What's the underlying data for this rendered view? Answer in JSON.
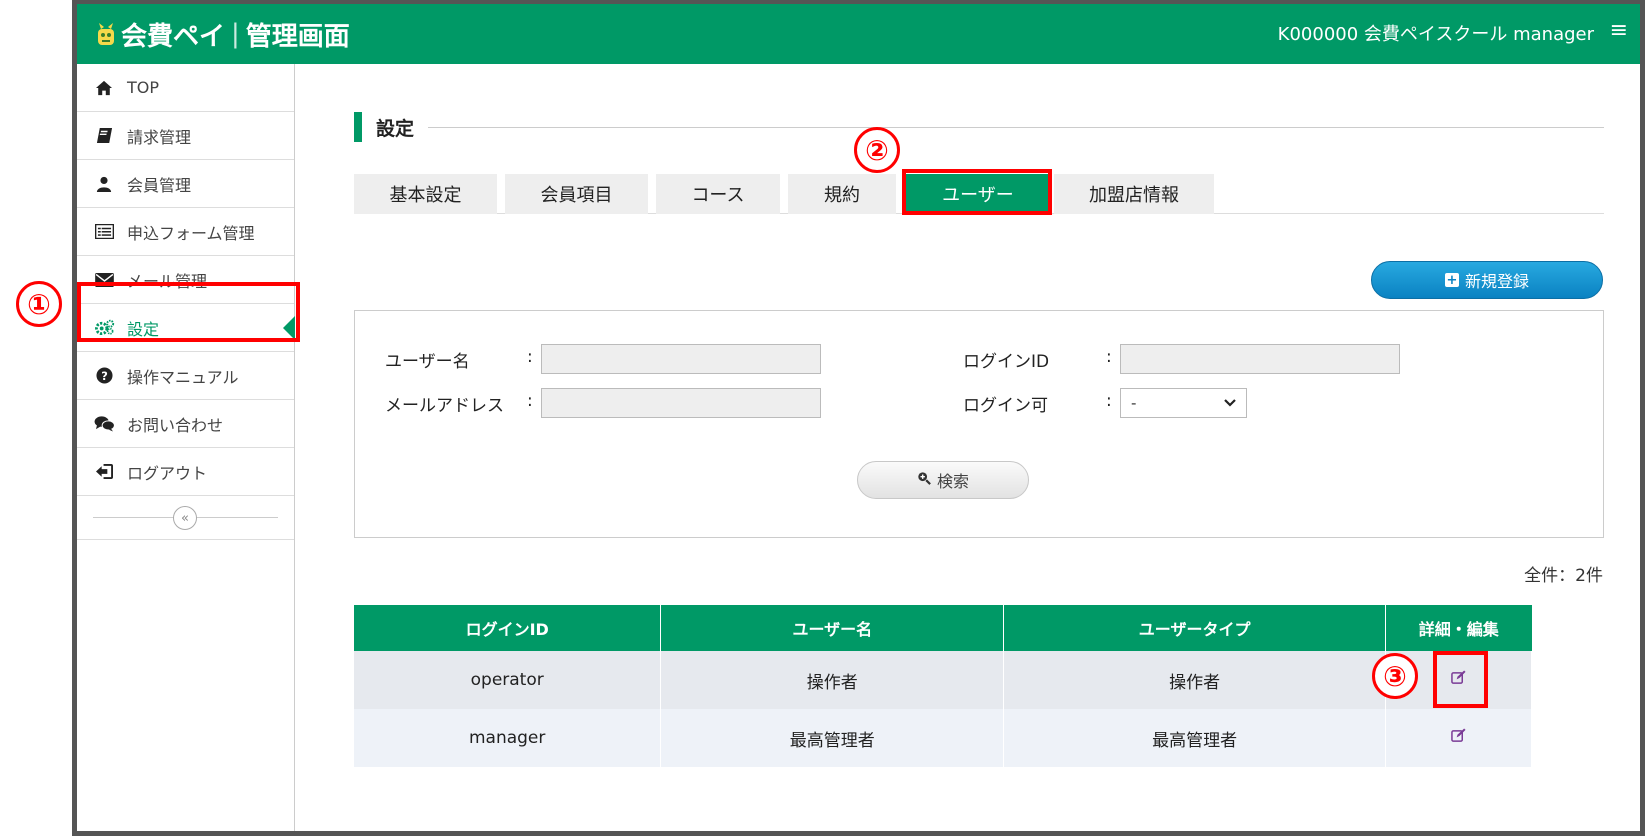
{
  "header": {
    "app_name": "会費ペイ",
    "separator": "|",
    "screen_name": "管理画面",
    "account_text": "K000000 会費ペイスクール manager",
    "menu_icon": "hamburger-icon"
  },
  "sidebar": {
    "items": [
      {
        "label": "TOP",
        "icon": "home-icon"
      },
      {
        "label": "請求管理",
        "icon": "book-icon"
      },
      {
        "label": "会員管理",
        "icon": "user-icon"
      },
      {
        "label": "申込フォーム管理",
        "icon": "list-icon"
      },
      {
        "label": "メール管理",
        "icon": "envelope-icon"
      },
      {
        "label": "設定",
        "icon": "gears-icon",
        "active": true
      },
      {
        "label": "操作マニュアル",
        "icon": "question-icon"
      },
      {
        "label": "お問い合わせ",
        "icon": "chat-icon"
      },
      {
        "label": "ログアウト",
        "icon": "logout-icon"
      }
    ],
    "collapse_glyph": "«"
  },
  "page": {
    "title": "設定",
    "tabs": [
      {
        "label": "基本設定"
      },
      {
        "label": "会員項目"
      },
      {
        "label": "コース"
      },
      {
        "label": "規約"
      },
      {
        "label": "ユーザー",
        "active": true
      },
      {
        "label": "加盟店情報"
      }
    ],
    "new_button": "新規登録"
  },
  "search": {
    "username_label": "ユーザー名",
    "email_label": "メールアドレス",
    "loginid_label": "ログインID",
    "loginable_label": "ログイン可",
    "colon": ":",
    "username_value": "",
    "email_value": "",
    "loginid_value": "",
    "loginable_value": "-",
    "button": "検索"
  },
  "results": {
    "count_text": "全件：2件",
    "columns": [
      "ログインID",
      "ユーザー名",
      "ユーザータイプ",
      "詳細・編集"
    ],
    "rows": [
      {
        "login_id": "operator",
        "user_name": "操作者",
        "user_type": "操作者"
      },
      {
        "login_id": "manager",
        "user_name": "最高管理者",
        "user_type": "最高管理者"
      }
    ]
  },
  "annotations": {
    "badges": [
      "①",
      "②",
      "③"
    ],
    "color": "#ff0000"
  },
  "colors": {
    "brand_green": "#009966",
    "button_blue": "#0a82c2",
    "edit_icon": "#7a3b96"
  }
}
